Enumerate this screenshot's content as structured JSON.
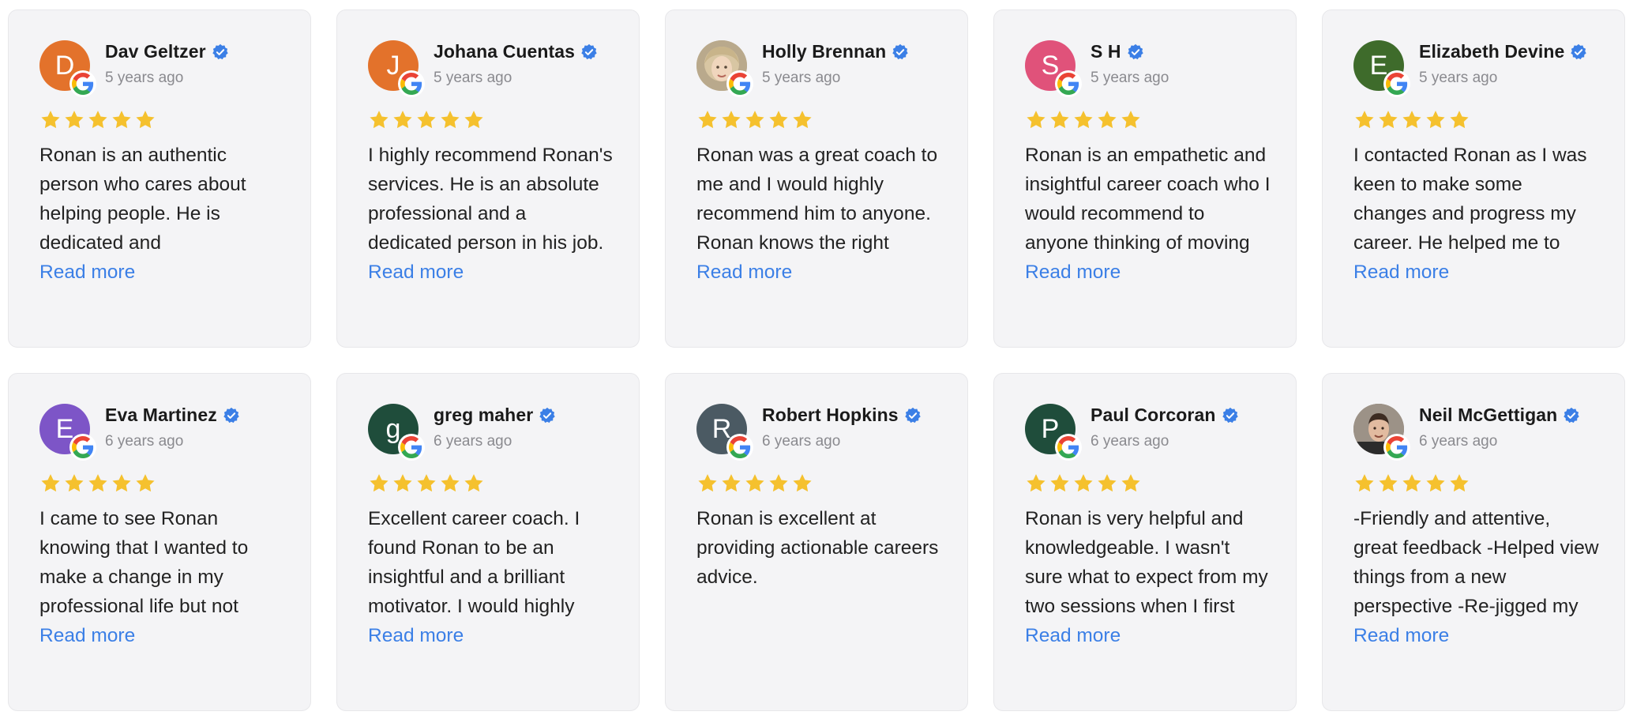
{
  "colors": {
    "card_background": "#f4f4f6",
    "star": "#f5c12e",
    "link": "#3b7fe6",
    "verified": "#3b7fe6"
  },
  "icons": {
    "rating": "star-icon",
    "verified": "verified-badge-icon",
    "source": "google-logo-icon"
  },
  "read_more_label": "Read more",
  "reviews": [
    {
      "name": "Dav Geltzer",
      "time": "5 years ago",
      "initial": "D",
      "avatar_color": "#e3722b",
      "rating": 5,
      "text": "Ronan is an authentic person who cares about helping people. He is dedicated and knowledgeable in many"
    },
    {
      "name": "Johana Cuentas",
      "time": "5 years ago",
      "initial": "J",
      "avatar_color": "#e3722b",
      "rating": 5,
      "text": "I highly recommend Ronan's services. He is an absolute professional and a dedicated person in his job. Should anyone be"
    },
    {
      "name": "Holly Brennan",
      "time": "5 years ago",
      "initial": "",
      "avatar_color": "#c9b89a",
      "rating": 5,
      "text": "Ronan was a great coach to me and I would highly recommend him to anyone. Ronan knows the right questions to ask and"
    },
    {
      "name": "S H",
      "time": "5 years ago",
      "initial": "S",
      "avatar_color": "#e0527a",
      "rating": 5,
      "text": "Ronan is an empathetic and insightful career coach who I would recommend to anyone thinking of moving on or"
    },
    {
      "name": "Elizabeth Devine",
      "time": "5 years ago",
      "initial": "E",
      "avatar_color": "#3e6b2b",
      "rating": 5,
      "text": "I contacted Ronan as I was keen to make some changes and progress my career. He helped me to identify the direction I"
    },
    {
      "name": "Eva Martinez",
      "time": "6 years ago",
      "initial": "E",
      "avatar_color": "#7d55c7",
      "rating": 5,
      "text": "I came to see Ronan knowing that I wanted to make a change in my professional life but not knowing where to start or"
    },
    {
      "name": "greg maher",
      "time": "6 years ago",
      "initial": "g",
      "avatar_color": "#1f4d3b",
      "rating": 5,
      "text": "Excellent career coach. I found Ronan to be an insightful and a brilliant motivator. I would highly recommend Ronan as an"
    },
    {
      "name": "Robert Hopkins",
      "time": "6 years ago",
      "initial": "R",
      "avatar_color": "#4b5a63",
      "rating": 5,
      "text": "Ronan is excellent at providing actionable careers advice."
    },
    {
      "name": "Paul Corcoran",
      "time": "6 years ago",
      "initial": "P",
      "avatar_color": "#1f4d3b",
      "rating": 5,
      "text": "Ronan is very helpful and knowledgeable. I wasn't sure what to expect from my two sessions when I first contacted him but he"
    },
    {
      "name": "Neil McGettigan",
      "time": "6 years ago",
      "initial": "",
      "avatar_color": "#8a7a6a",
      "rating": 5,
      "text": "-Friendly and attentive, great feedback -Helped view things from a new perspective -Re-jigged my CV to reflect best"
    }
  ]
}
